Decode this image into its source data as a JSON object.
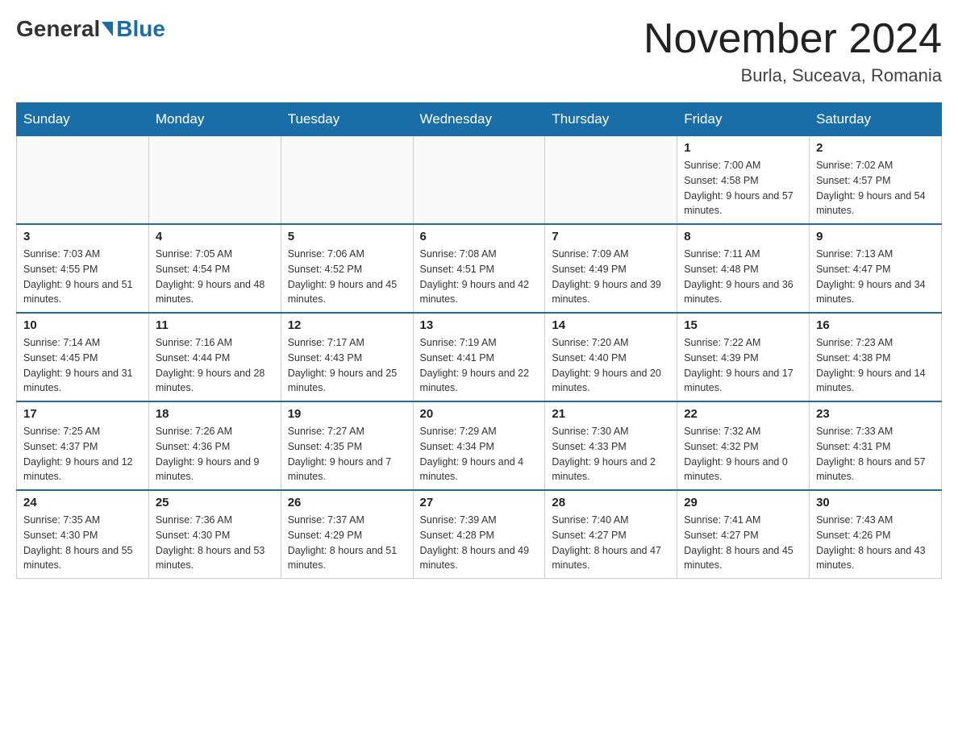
{
  "header": {
    "logo_general": "General",
    "logo_blue": "Blue",
    "title": "November 2024",
    "location": "Burla, Suceava, Romania"
  },
  "weekdays": [
    "Sunday",
    "Monday",
    "Tuesday",
    "Wednesday",
    "Thursday",
    "Friday",
    "Saturday"
  ],
  "weeks": [
    [
      {
        "day": "",
        "sunrise": "",
        "sunset": "",
        "daylight": ""
      },
      {
        "day": "",
        "sunrise": "",
        "sunset": "",
        "daylight": ""
      },
      {
        "day": "",
        "sunrise": "",
        "sunset": "",
        "daylight": ""
      },
      {
        "day": "",
        "sunrise": "",
        "sunset": "",
        "daylight": ""
      },
      {
        "day": "",
        "sunrise": "",
        "sunset": "",
        "daylight": ""
      },
      {
        "day": "1",
        "sunrise": "Sunrise: 7:00 AM",
        "sunset": "Sunset: 4:58 PM",
        "daylight": "Daylight: 9 hours and 57 minutes."
      },
      {
        "day": "2",
        "sunrise": "Sunrise: 7:02 AM",
        "sunset": "Sunset: 4:57 PM",
        "daylight": "Daylight: 9 hours and 54 minutes."
      }
    ],
    [
      {
        "day": "3",
        "sunrise": "Sunrise: 7:03 AM",
        "sunset": "Sunset: 4:55 PM",
        "daylight": "Daylight: 9 hours and 51 minutes."
      },
      {
        "day": "4",
        "sunrise": "Sunrise: 7:05 AM",
        "sunset": "Sunset: 4:54 PM",
        "daylight": "Daylight: 9 hours and 48 minutes."
      },
      {
        "day": "5",
        "sunrise": "Sunrise: 7:06 AM",
        "sunset": "Sunset: 4:52 PM",
        "daylight": "Daylight: 9 hours and 45 minutes."
      },
      {
        "day": "6",
        "sunrise": "Sunrise: 7:08 AM",
        "sunset": "Sunset: 4:51 PM",
        "daylight": "Daylight: 9 hours and 42 minutes."
      },
      {
        "day": "7",
        "sunrise": "Sunrise: 7:09 AM",
        "sunset": "Sunset: 4:49 PM",
        "daylight": "Daylight: 9 hours and 39 minutes."
      },
      {
        "day": "8",
        "sunrise": "Sunrise: 7:11 AM",
        "sunset": "Sunset: 4:48 PM",
        "daylight": "Daylight: 9 hours and 36 minutes."
      },
      {
        "day": "9",
        "sunrise": "Sunrise: 7:13 AM",
        "sunset": "Sunset: 4:47 PM",
        "daylight": "Daylight: 9 hours and 34 minutes."
      }
    ],
    [
      {
        "day": "10",
        "sunrise": "Sunrise: 7:14 AM",
        "sunset": "Sunset: 4:45 PM",
        "daylight": "Daylight: 9 hours and 31 minutes."
      },
      {
        "day": "11",
        "sunrise": "Sunrise: 7:16 AM",
        "sunset": "Sunset: 4:44 PM",
        "daylight": "Daylight: 9 hours and 28 minutes."
      },
      {
        "day": "12",
        "sunrise": "Sunrise: 7:17 AM",
        "sunset": "Sunset: 4:43 PM",
        "daylight": "Daylight: 9 hours and 25 minutes."
      },
      {
        "day": "13",
        "sunrise": "Sunrise: 7:19 AM",
        "sunset": "Sunset: 4:41 PM",
        "daylight": "Daylight: 9 hours and 22 minutes."
      },
      {
        "day": "14",
        "sunrise": "Sunrise: 7:20 AM",
        "sunset": "Sunset: 4:40 PM",
        "daylight": "Daylight: 9 hours and 20 minutes."
      },
      {
        "day": "15",
        "sunrise": "Sunrise: 7:22 AM",
        "sunset": "Sunset: 4:39 PM",
        "daylight": "Daylight: 9 hours and 17 minutes."
      },
      {
        "day": "16",
        "sunrise": "Sunrise: 7:23 AM",
        "sunset": "Sunset: 4:38 PM",
        "daylight": "Daylight: 9 hours and 14 minutes."
      }
    ],
    [
      {
        "day": "17",
        "sunrise": "Sunrise: 7:25 AM",
        "sunset": "Sunset: 4:37 PM",
        "daylight": "Daylight: 9 hours and 12 minutes."
      },
      {
        "day": "18",
        "sunrise": "Sunrise: 7:26 AM",
        "sunset": "Sunset: 4:36 PM",
        "daylight": "Daylight: 9 hours and 9 minutes."
      },
      {
        "day": "19",
        "sunrise": "Sunrise: 7:27 AM",
        "sunset": "Sunset: 4:35 PM",
        "daylight": "Daylight: 9 hours and 7 minutes."
      },
      {
        "day": "20",
        "sunrise": "Sunrise: 7:29 AM",
        "sunset": "Sunset: 4:34 PM",
        "daylight": "Daylight: 9 hours and 4 minutes."
      },
      {
        "day": "21",
        "sunrise": "Sunrise: 7:30 AM",
        "sunset": "Sunset: 4:33 PM",
        "daylight": "Daylight: 9 hours and 2 minutes."
      },
      {
        "day": "22",
        "sunrise": "Sunrise: 7:32 AM",
        "sunset": "Sunset: 4:32 PM",
        "daylight": "Daylight: 9 hours and 0 minutes."
      },
      {
        "day": "23",
        "sunrise": "Sunrise: 7:33 AM",
        "sunset": "Sunset: 4:31 PM",
        "daylight": "Daylight: 8 hours and 57 minutes."
      }
    ],
    [
      {
        "day": "24",
        "sunrise": "Sunrise: 7:35 AM",
        "sunset": "Sunset: 4:30 PM",
        "daylight": "Daylight: 8 hours and 55 minutes."
      },
      {
        "day": "25",
        "sunrise": "Sunrise: 7:36 AM",
        "sunset": "Sunset: 4:30 PM",
        "daylight": "Daylight: 8 hours and 53 minutes."
      },
      {
        "day": "26",
        "sunrise": "Sunrise: 7:37 AM",
        "sunset": "Sunset: 4:29 PM",
        "daylight": "Daylight: 8 hours and 51 minutes."
      },
      {
        "day": "27",
        "sunrise": "Sunrise: 7:39 AM",
        "sunset": "Sunset: 4:28 PM",
        "daylight": "Daylight: 8 hours and 49 minutes."
      },
      {
        "day": "28",
        "sunrise": "Sunrise: 7:40 AM",
        "sunset": "Sunset: 4:27 PM",
        "daylight": "Daylight: 8 hours and 47 minutes."
      },
      {
        "day": "29",
        "sunrise": "Sunrise: 7:41 AM",
        "sunset": "Sunset: 4:27 PM",
        "daylight": "Daylight: 8 hours and 45 minutes."
      },
      {
        "day": "30",
        "sunrise": "Sunrise: 7:43 AM",
        "sunset": "Sunset: 4:26 PM",
        "daylight": "Daylight: 8 hours and 43 minutes."
      }
    ]
  ]
}
